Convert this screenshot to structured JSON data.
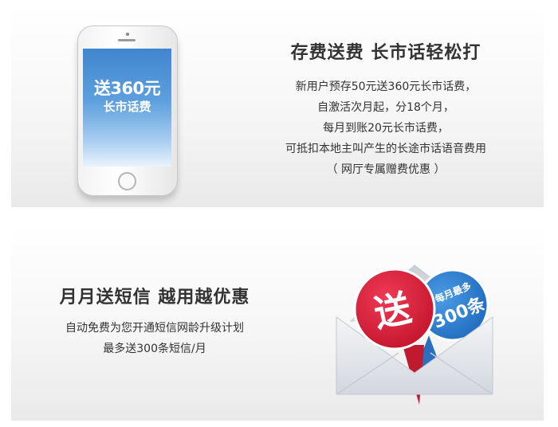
{
  "promo1": {
    "phone_screen_line1": "送360元",
    "phone_screen_line2": "长市话费",
    "title": "存费送费  长市话轻松打",
    "lines": [
      "新用户预存50元送360元长市话费，",
      "自激活次月起，分18个月，",
      "每月到账20元长市话费，",
      "可抵扣本地主叫产生的长途市话语音费用",
      "（ 网厅专属赠费优惠 ）"
    ]
  },
  "promo2": {
    "title": "月月送短信  越用越优惠",
    "lines": [
      "自动免费为您开通短信网龄升级计划",
      "最多送300条短信/月"
    ],
    "badge_red_text": "送",
    "badge_blue_line1": "每月最多",
    "badge_blue_line2": "300条"
  },
  "colors": {
    "phone_screen_blue": "#3f86cf",
    "badge_red": "#d8203a",
    "badge_blue": "#2f7fd0"
  }
}
